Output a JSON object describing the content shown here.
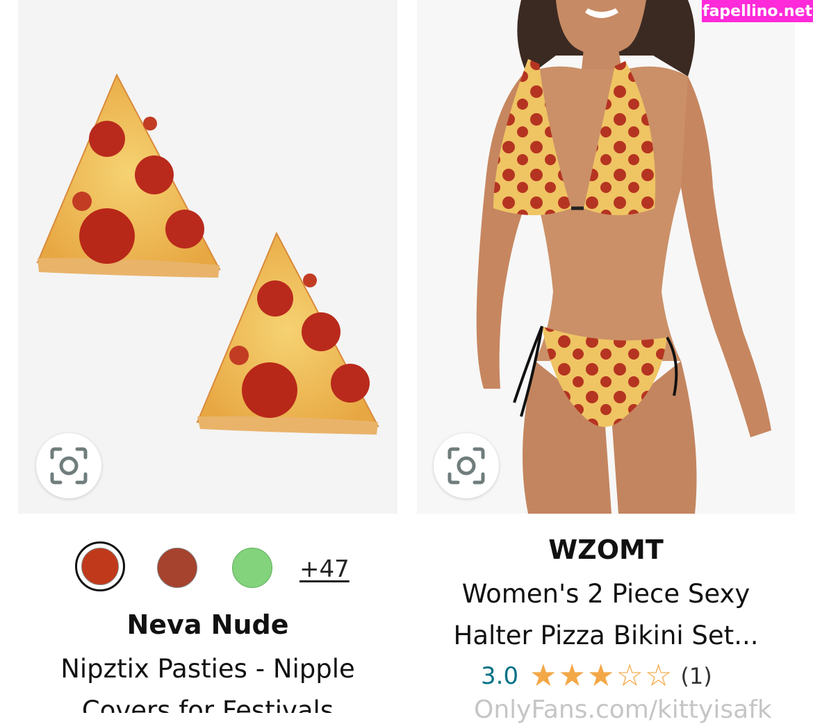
{
  "watermark": {
    "site": "fapellino.net",
    "bottom_text": "OnlyFans.com/kittyisafk"
  },
  "colors": {
    "rating_link": "#007185",
    "star": "#f3a847",
    "watermark_bg": "#ff2ad9"
  },
  "products": [
    {
      "brand": "Neva Nude",
      "title_line1": "Nipztix Pasties - Nipple",
      "title_line2": "Covers for Festivals",
      "image_description_icon": "pizza-slice-icon",
      "swatches": [
        {
          "name": "swatch-dark-red",
          "color": "#c0391b",
          "selected": true
        },
        {
          "name": "swatch-brown-red",
          "color": "#a6432e",
          "selected": false
        },
        {
          "name": "swatch-green",
          "color": "#83d27c",
          "selected": false
        }
      ],
      "more_colors": "+47"
    },
    {
      "brand": "WZOMT",
      "title_line1": "Women's 2 Piece Sexy",
      "title_line2": "Halter Pizza Bikini Set...",
      "rating": {
        "value": "3.0",
        "stars": 3,
        "max": 5,
        "count": "(1)"
      }
    }
  ]
}
